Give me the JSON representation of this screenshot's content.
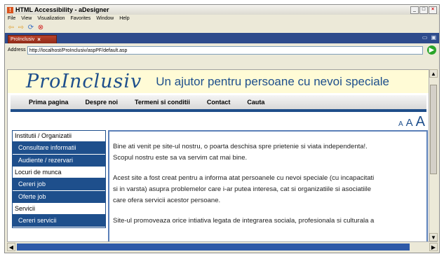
{
  "window": {
    "title": "HTML Accessibility - aDesigner",
    "controls": [
      "_",
      "□",
      "×"
    ]
  },
  "menu": [
    "File",
    "View",
    "Visualization",
    "Favorites",
    "Window",
    "Help"
  ],
  "tab": {
    "label": "ProInclusiv",
    "close": "×"
  },
  "address": {
    "label": "Address",
    "value": "http://localhost/ProInclusiv/aspPF/default.asp"
  },
  "site": {
    "logo": "ProInclusiv",
    "tagline": "Un ajutor pentru persoane cu nevoi speciale",
    "nav": [
      "Prima pagina",
      "Despre noi",
      "Termeni si conditii",
      "Contact",
      "Cauta"
    ],
    "font_sizes": [
      "A",
      "A",
      "A"
    ],
    "sidebar": [
      {
        "type": "category",
        "label": "Institutii / Organizatii"
      },
      {
        "type": "item",
        "label": "Consultare informatii"
      },
      {
        "type": "item",
        "label": "Audiente / rezervari"
      },
      {
        "type": "category",
        "label": "Locuri de munca"
      },
      {
        "type": "item",
        "label": "Cereri job"
      },
      {
        "type": "item",
        "label": "Oferte job"
      },
      {
        "type": "category",
        "label": "Servicii"
      },
      {
        "type": "item",
        "label": "Cereri servicii"
      }
    ],
    "content": [
      [
        "Bine ati venit pe site-ul nostru, o poarta deschisa spre prietenie si viata independenta!.",
        "Scopul nostru este sa va servim cat mai bine."
      ],
      [
        "Acest site a fost creat pentru a informa atat persoanele cu nevoi speciale (cu incapacitati",
        "si in varsta) asupra problemelor care i-ar putea interesa, cat si organizatiile si asociatiile",
        "care ofera servicii acestor persoane."
      ],
      [
        "Site-ul promoveaza orice intiativa legata de integrarea sociala, profesionala si culturala a"
      ]
    ]
  },
  "colors": {
    "brand": "#1e4f8c",
    "header_bg": "#fffbd6",
    "tab": "#b9422a"
  }
}
